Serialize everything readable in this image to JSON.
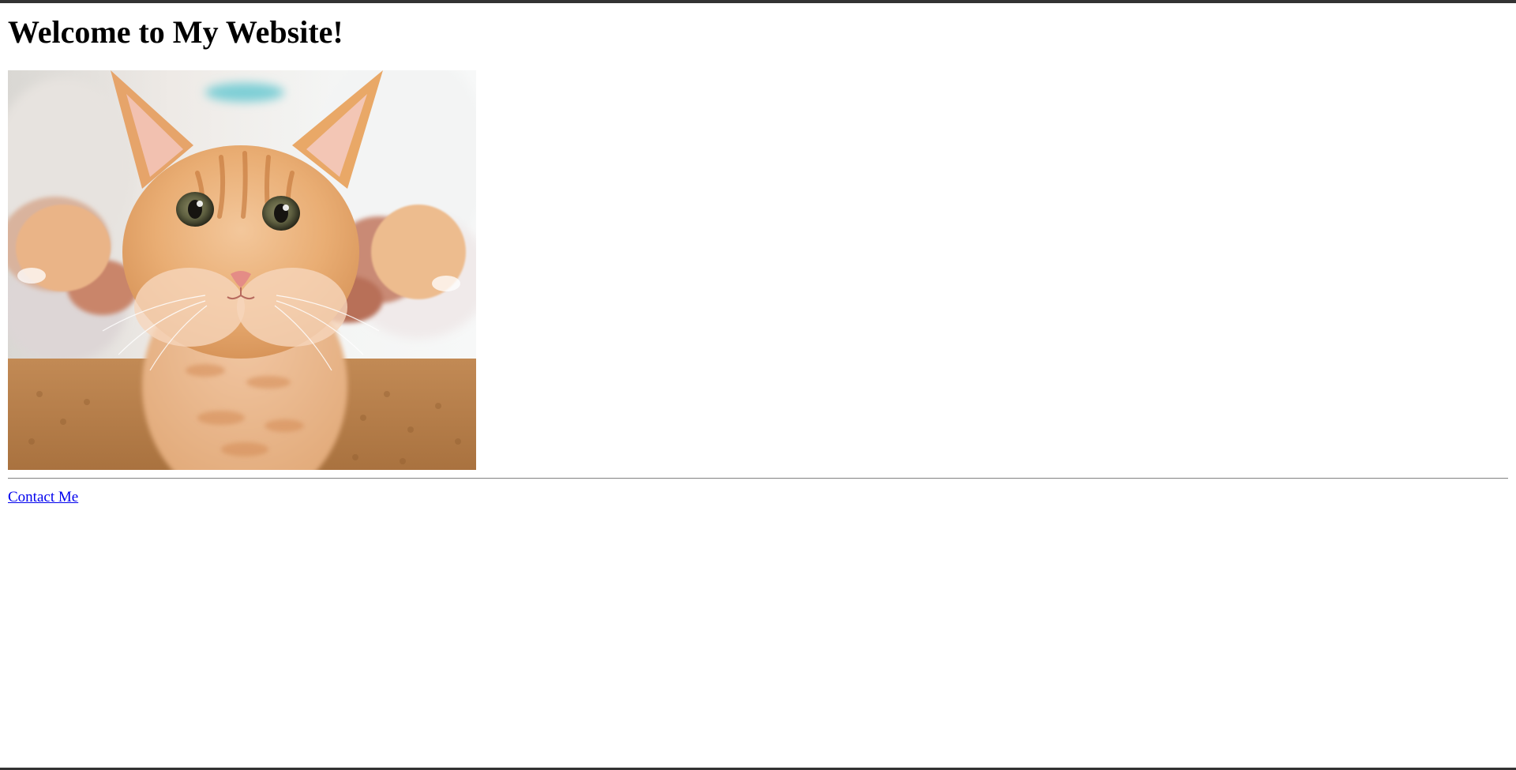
{
  "page": {
    "title": "Welcome to My Website!"
  },
  "image": {
    "subject": "kitten-photo"
  },
  "links": {
    "contact_label": "Contact Me"
  },
  "colors": {
    "link": "#0000ee",
    "frame_border": "#333333",
    "divider": "#8a8a8a"
  }
}
